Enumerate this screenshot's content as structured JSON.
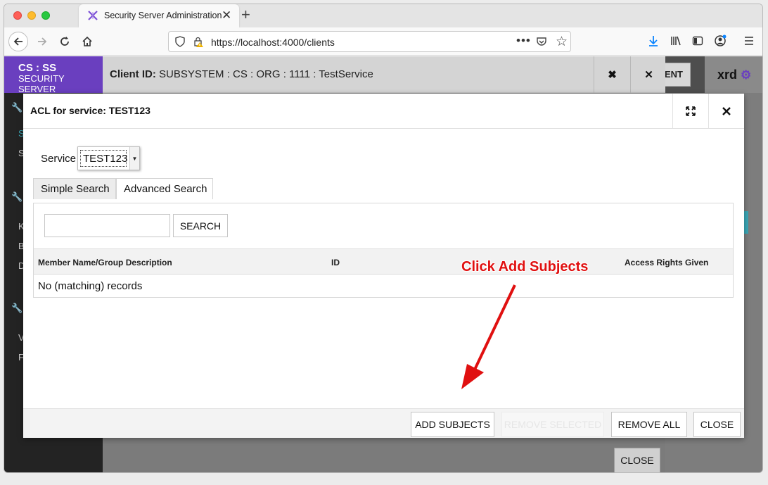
{
  "browser": {
    "tab_title": "Security Server Administration",
    "new_tab_glyph": "+",
    "close_tab_glyph": "✕",
    "url": "https://localhost:4000/clients",
    "url_more": "•••"
  },
  "app": {
    "brand_line1": "CS : SS",
    "brand_line2": "SECURITY SERVER",
    "sidebar_letters": [
      "S",
      "S",
      "K",
      "B",
      "D",
      "V",
      "F"
    ],
    "background_client_button": "ENT",
    "user": "xrd"
  },
  "client_dialog": {
    "title_label": "Client ID:",
    "title_value": "SUBSYSTEM : CS : ORG : 1111 : TestService",
    "close_button": "CLOSE"
  },
  "acl_dialog": {
    "title": "ACL for service: TEST123",
    "service_label": "Service",
    "service_value": "TEST123",
    "tabs": [
      "Simple Search",
      "Advanced Search"
    ],
    "search_value": "",
    "search_button": "SEARCH",
    "columns": [
      "Member Name/Group Description",
      "ID",
      "Access Rights Given"
    ],
    "empty_message": "No (matching) records",
    "buttons": {
      "add_subjects": "ADD SUBJECTS",
      "remove_selected": "REMOVE SELECTED",
      "remove_all": "REMOVE ALL",
      "close": "CLOSE"
    }
  },
  "annotation": {
    "text": "Click Add Subjects",
    "color": "#e01010"
  },
  "colors": {
    "brand": "#6a3fbf",
    "sidebar": "#232323",
    "accent_teal": "#3aa7b6"
  }
}
